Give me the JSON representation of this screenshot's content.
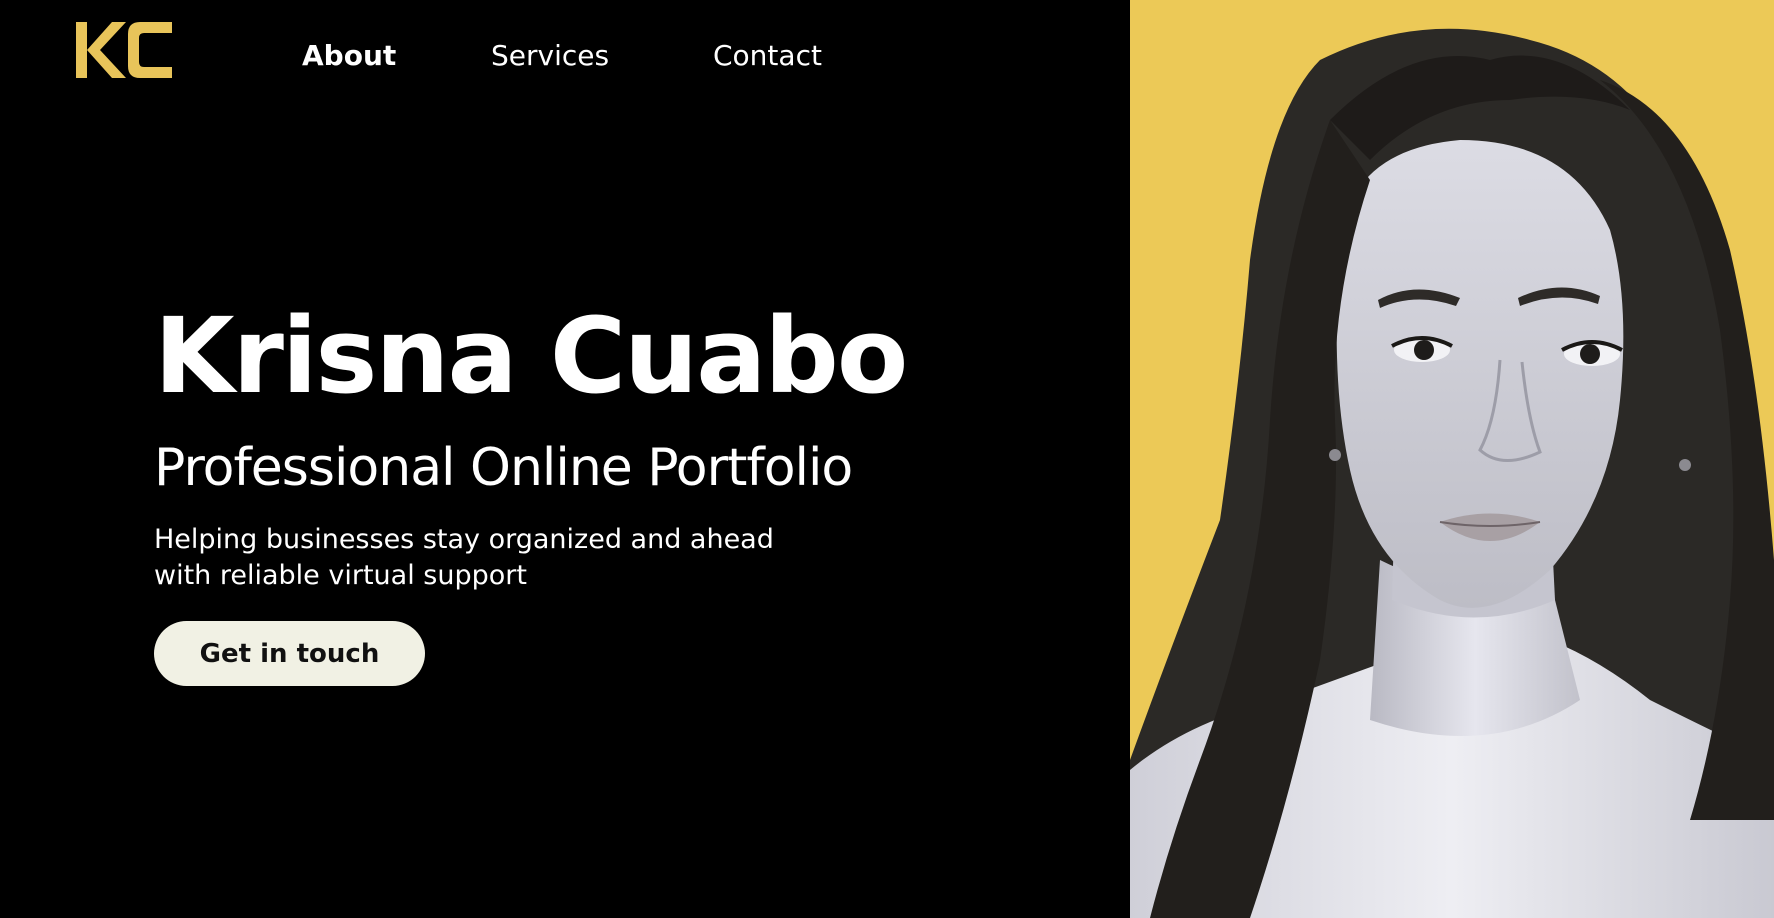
{
  "logo": {
    "text": "KC",
    "color": "#e8c45a"
  },
  "nav": {
    "items": [
      {
        "label": "About",
        "active": true
      },
      {
        "label": "Services",
        "active": false
      },
      {
        "label": "Contact",
        "active": false
      }
    ]
  },
  "hero": {
    "name": "Krisna Cuabo",
    "subtitle": "Professional Online Portfolio",
    "tagline": "Helping businesses stay organized and ahead with reliable virtual support",
    "cta_label": "Get in touch"
  },
  "portrait": {
    "alt": "Krisna Cuabo",
    "background_color": "#ecc957"
  },
  "colors": {
    "background": "#000000",
    "accent": "#ecc957",
    "text": "#ffffff",
    "button_bg": "#f1f1e4"
  }
}
